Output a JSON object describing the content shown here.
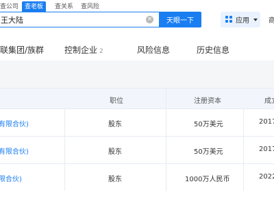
{
  "search_tabs": [
    "查公司",
    "查老板",
    "查关系",
    "查风险"
  ],
  "search": {
    "query": "王大陆",
    "button": "天眼一下",
    "clear_icon": "close-circle-icon"
  },
  "header": {
    "apps_label": "应用",
    "apps_icon": "grid-icon",
    "merchant_label": "商"
  },
  "nav_tabs": [
    {
      "label": "关联集团/族群"
    },
    {
      "label": "控制企业",
      "count": "2"
    },
    {
      "label": "风险信息"
    },
    {
      "label": "历史信息"
    }
  ],
  "table": {
    "headers": [
      "职位",
      "注册资本",
      "成立"
    ],
    "rows": [
      {
        "company": "有限合伙)",
        "position": "股东",
        "capital": "50万美元",
        "date": "2017"
      },
      {
        "company": "有限合伙)",
        "position": "股东",
        "capital": "50万美元",
        "date": "2017"
      },
      {
        "company": "限合伙)",
        "position": "股东",
        "capital": "1000万人民币",
        "date": "2022"
      }
    ]
  },
  "colors": {
    "accent": "#1a7ef2",
    "header_bg": "#f2f6fc",
    "page_bg": "#f5f6f8"
  }
}
